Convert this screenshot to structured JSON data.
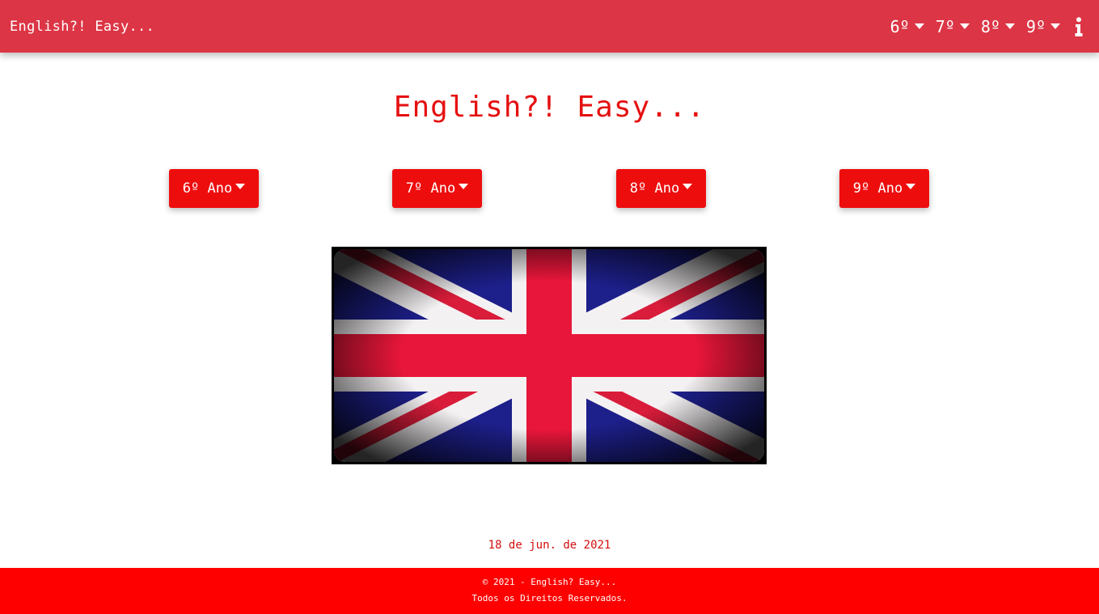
{
  "navbar": {
    "brand": "English?! Easy...",
    "items": [
      {
        "label": "6º"
      },
      {
        "label": "7º"
      },
      {
        "label": "8º"
      },
      {
        "label": "9º"
      }
    ],
    "info_icon": "info-icon"
  },
  "main": {
    "title": "English?! Easy...",
    "grade_buttons": [
      {
        "label": "6º Ano"
      },
      {
        "label": "7º Ano"
      },
      {
        "label": "8º Ano"
      },
      {
        "label": "9º Ano"
      }
    ],
    "flag_image": "union-jack-flag"
  },
  "date": "18 de jun. de 2021",
  "footer": {
    "copyright": "© 2021 - English? Easy...",
    "rights": "Todos os Direitos Reservados."
  },
  "colors": {
    "navbar": "#dc3545",
    "title": "#e51010",
    "button": "#ee0d0d",
    "footer": "#ff0000"
  }
}
